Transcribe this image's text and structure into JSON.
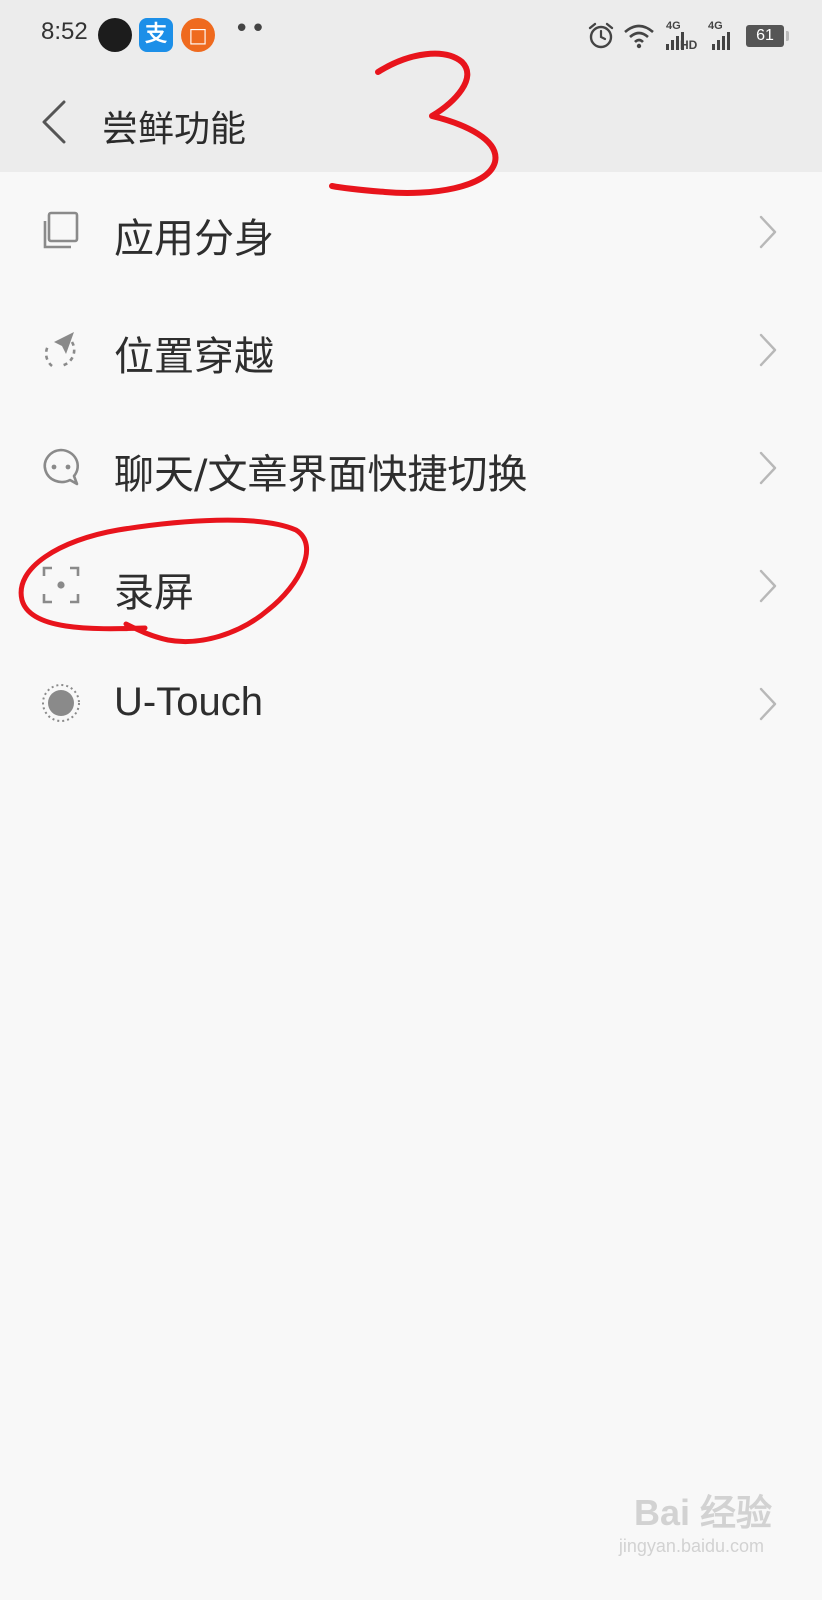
{
  "status_bar": {
    "time": "8:52",
    "notification_icons": [
      "black-dot-icon",
      "alipay-icon",
      "orange-app-icon"
    ],
    "alipay_glyph": "支",
    "orange_glyph": "□",
    "more": "••",
    "network_top_1": "4G",
    "network_hd": "HD",
    "network_top_2": "4G",
    "battery": "61"
  },
  "app_bar": {
    "title": "尝鲜功能",
    "back_icon": "chevron-left-icon"
  },
  "list": {
    "items": [
      {
        "label": "应用分身",
        "icon": "app-clone-icon"
      },
      {
        "label": "位置穿越",
        "icon": "location-travel-icon"
      },
      {
        "label": "聊天/文章界面快捷切换",
        "icon": "chat-bubble-icon"
      },
      {
        "label": "录屏",
        "icon": "screen-record-icon"
      },
      {
        "label": "U-Touch",
        "icon": "u-touch-icon"
      }
    ]
  },
  "annotations": {
    "step_number": "3",
    "color": "#e8141c"
  },
  "watermark": {
    "main": "Bai 经验",
    "sub": "jingyan.baidu.com"
  },
  "colors": {
    "header_bg": "#ececec",
    "page_bg": "#f8f8f8",
    "text": "#2b2b2b",
    "icon": "#8a8a8a",
    "alipay": "#1c8fe8",
    "orange_app": "#ef6a1e"
  }
}
